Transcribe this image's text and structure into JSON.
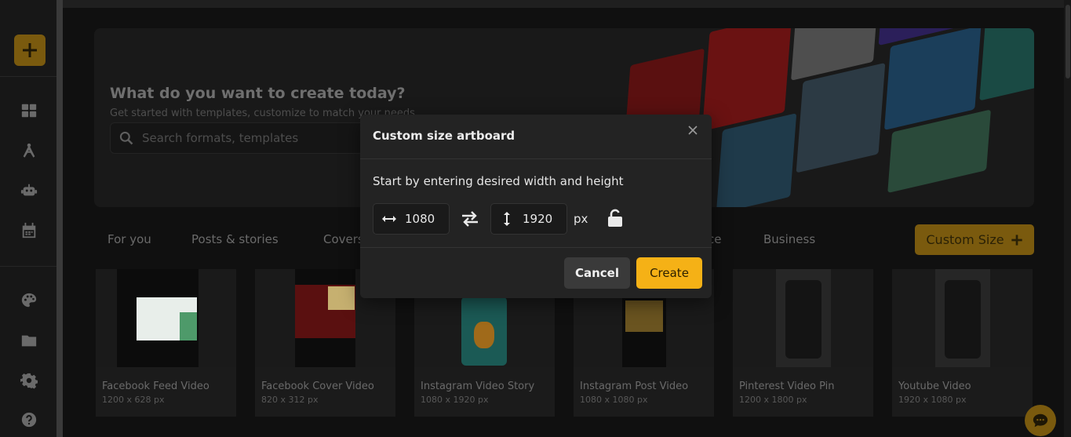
{
  "sidebar": {
    "add_icon": "plus-icon",
    "items": [
      {
        "name": "dashboard-icon"
      },
      {
        "name": "design-tools-icon"
      },
      {
        "name": "robot-icon"
      },
      {
        "name": "calendar-icon"
      },
      {
        "name": "palette-icon"
      },
      {
        "name": "folder-icon"
      },
      {
        "name": "gear-icon"
      },
      {
        "name": "help-icon"
      }
    ]
  },
  "hero": {
    "title": "What do you want to create today?",
    "subtitle": "Get started with templates, customize to match your needs",
    "search_placeholder": "Search formats, templates"
  },
  "tabs": [
    "For you",
    "Posts & stories",
    "Covers",
    "ce",
    "Business"
  ],
  "custom_size_label": "Custom Size",
  "cards": [
    {
      "title": "Facebook Feed Video",
      "size": "1200 x 628 px"
    },
    {
      "title": "Facebook Cover Video",
      "size": "820 x 312 px"
    },
    {
      "title": "Instagram Video Story",
      "size": "1080 x 1920 px"
    },
    {
      "title": "Instagram Post Video",
      "size": "1080 x 1080 px"
    },
    {
      "title": "Pinterest Video Pin",
      "size": "1200 x 1800 px"
    },
    {
      "title": "Youtube Video",
      "size": "1920 x 1080 px"
    }
  ],
  "modal": {
    "title": "Custom size artboard",
    "instruction": "Start by entering desired width and height",
    "width_value": "1080",
    "height_value": "1920",
    "unit": "px",
    "cancel_label": "Cancel",
    "create_label": "Create"
  },
  "colors": {
    "accent": "#f5b116",
    "accent_dim": "#7a5a0e",
    "modal_bg": "#232323"
  }
}
